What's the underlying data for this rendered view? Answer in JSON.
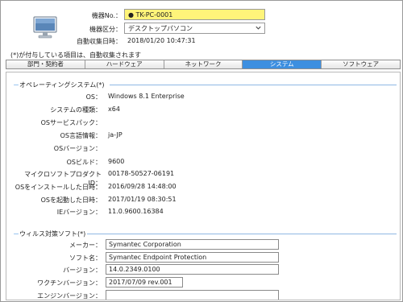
{
  "header": {
    "device_no_label": "機器No.：",
    "device_no_value": "● TK-PC-0001",
    "device_type_label": "機器区分：",
    "device_type_value": "デスクトップパソコン",
    "auto_collect_label": "自動収集日時：",
    "auto_collect_value": "2018/01/20 10:47:31"
  },
  "note": "(*)が付与している項目は、自動収集されます",
  "tabs": [
    {
      "label": "部門・契約者",
      "active": false
    },
    {
      "label": "ハードウェア",
      "active": false
    },
    {
      "label": "ネットワーク",
      "active": false
    },
    {
      "label": "システム",
      "active": true
    },
    {
      "label": "ソフトウェア",
      "active": false
    }
  ],
  "os_section": {
    "title": "オペレーティングシステム(*)",
    "rows": [
      {
        "label": "OS：",
        "value": "Windows 8.1 Enterprise"
      },
      {
        "label": "システムの種類：",
        "value": "x64"
      },
      {
        "label": "OSサービスパック：",
        "value": ""
      },
      {
        "label": "OS言語情報：",
        "value": "ja-JP"
      },
      {
        "label": "OSバージョン：",
        "value": ""
      },
      {
        "label": "OSビルド：",
        "value": "9600"
      },
      {
        "label": "マイクロソフトプロダクトID：",
        "value": "00178-50527-06191"
      },
      {
        "label": "OSをインストールした日時：",
        "value": "2016/09/28 14:48:00"
      },
      {
        "label": "OSを起動した日時：",
        "value": "2017/01/19 08:30:51"
      },
      {
        "label": "IEバージョン：",
        "value": "11.0.9600.16384"
      }
    ]
  },
  "av_section": {
    "title": "ウィルス対策ソフト(*)",
    "rows": [
      {
        "label": "メーカー：",
        "value": "Symantec Corporation"
      },
      {
        "label": "ソフト名：",
        "value": "Symantec Endpoint Protection"
      },
      {
        "label": "バージョン：",
        "value": "14.0.2349.0100"
      },
      {
        "label": "ワクチンバージョン：",
        "value": "2017/07/09 rev.001"
      },
      {
        "label": "エンジンバージョン：",
        "value": ""
      }
    ]
  },
  "icons": {
    "device": "desktop-monitor-icon",
    "dropdown": "chevron-down-icon"
  },
  "colors": {
    "active_tab": "#3d8fe0",
    "device_no_highlight": "#fff47a",
    "section_line": "#8fb8e4"
  }
}
